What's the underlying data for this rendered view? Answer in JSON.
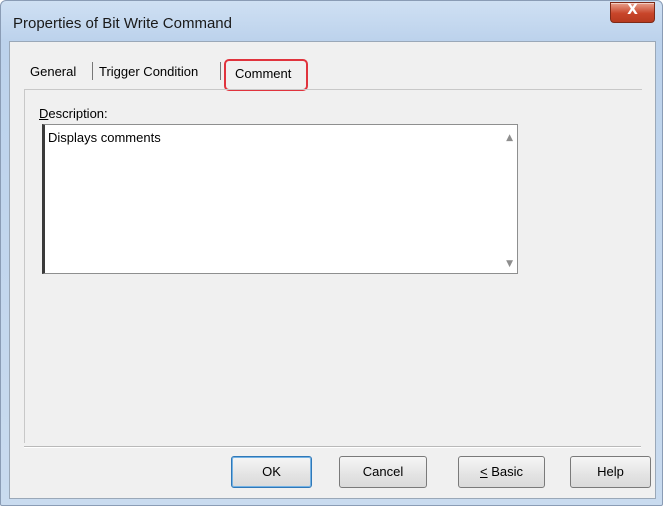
{
  "window": {
    "title": "Properties of Bit Write Command",
    "close_glyph": "X"
  },
  "tabs": [
    {
      "label": "General",
      "active": false
    },
    {
      "label": "Trigger Condition",
      "active": false
    },
    {
      "label": "Comment",
      "active": true
    }
  ],
  "comment_tab": {
    "description_label_first": "D",
    "description_label_rest": "escription:",
    "description_value": "Displays comments"
  },
  "buttons": {
    "ok": "OK",
    "cancel": "Cancel",
    "basic_prefix": "<",
    "basic_label": " Basic",
    "help": "Help"
  },
  "colors": {
    "highlight_border": "#e0333d",
    "title_bar": "#bcd2ec",
    "close_button": "#c8452a"
  }
}
